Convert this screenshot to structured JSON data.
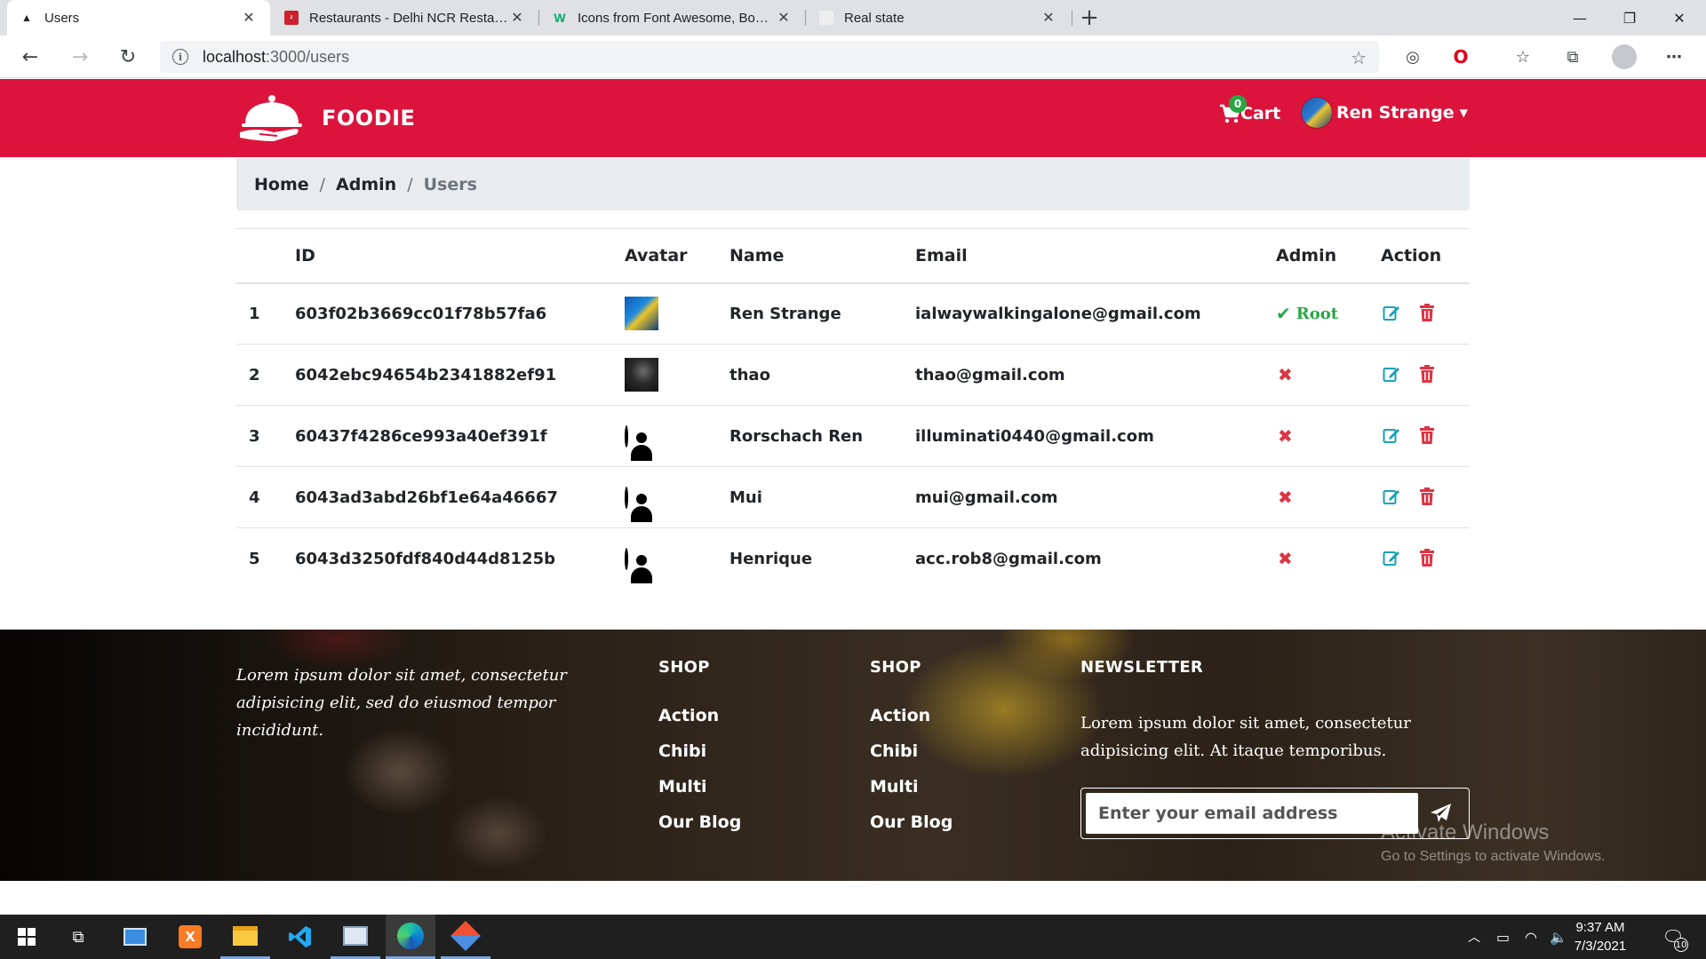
{
  "browser": {
    "tabs": [
      {
        "title": "Users",
        "icon": "triangle-icon",
        "active": true
      },
      {
        "title": "Restaurants - Delhi NCR Restaurants",
        "icon": "zomato-icon",
        "active": false
      },
      {
        "title": "Icons from Font Awesome, Bootstrap",
        "icon": "w3schools-icon",
        "active": false
      },
      {
        "title": "Real state",
        "icon": "page-icon",
        "active": false
      }
    ],
    "url_host": "localhost",
    "url_path": ":3000/users"
  },
  "header": {
    "brand": "FOODIE",
    "cart_label": "Cart",
    "cart_count": "0",
    "user_name": "Ren Strange",
    "accent_color": "#dc143c"
  },
  "breadcrumb": {
    "items": [
      "Home",
      "Admin"
    ],
    "active": "Users"
  },
  "table": {
    "headers": {
      "id": "ID",
      "avatar": "Avatar",
      "name": "Name",
      "email": "Email",
      "admin": "Admin",
      "action": "Action"
    },
    "rows": [
      {
        "num": "1",
        "id": "603f02b3669cc01f78b57fa6",
        "avatar": "custom-blue",
        "name": "Ren Strange",
        "email": "ialwaywalkingalone@gmail.com",
        "admin": "Root"
      },
      {
        "num": "2",
        "id": "6042ebc94654b2341882ef91",
        "avatar": "custom-dark",
        "name": "thao",
        "email": "thao@gmail.com",
        "admin": ""
      },
      {
        "num": "3",
        "id": "60437f4286ce993a40ef391f",
        "avatar": "default",
        "name": "Rorschach Ren",
        "email": "illuminati0440@gmail.com",
        "admin": ""
      },
      {
        "num": "4",
        "id": "6043ad3abd26bf1e64a46667",
        "avatar": "default",
        "name": "Mui",
        "email": "mui@gmail.com",
        "admin": ""
      },
      {
        "num": "5",
        "id": "6043d3250fdf840d44d8125b",
        "avatar": "default",
        "name": "Henrique",
        "email": "acc.rob8@gmail.com",
        "admin": ""
      }
    ]
  },
  "footer": {
    "about": "Lorem ipsum dolor sit amet, consectetur adipisicing elit, sed do eiusmod tempor incididunt.",
    "columns": [
      {
        "title": "SHOP",
        "links": [
          "Action",
          "Chibi",
          "Multi",
          "Our Blog"
        ]
      },
      {
        "title": "SHOP",
        "links": [
          "Action",
          "Chibi",
          "Multi",
          "Our Blog"
        ]
      }
    ],
    "newsletter_title": "NEWSLETTER",
    "newsletter_text": "Lorem ipsum dolor sit amet, consectetur adipisicing elit. At itaque temporibus.",
    "newsletter_placeholder": "Enter your email address"
  },
  "watermark": {
    "title": "Activate Windows",
    "subtitle": "Go to Settings to activate Windows."
  },
  "taskbar": {
    "time": "9:37 AM",
    "date": "7/3/2021",
    "notification_count": "10"
  }
}
